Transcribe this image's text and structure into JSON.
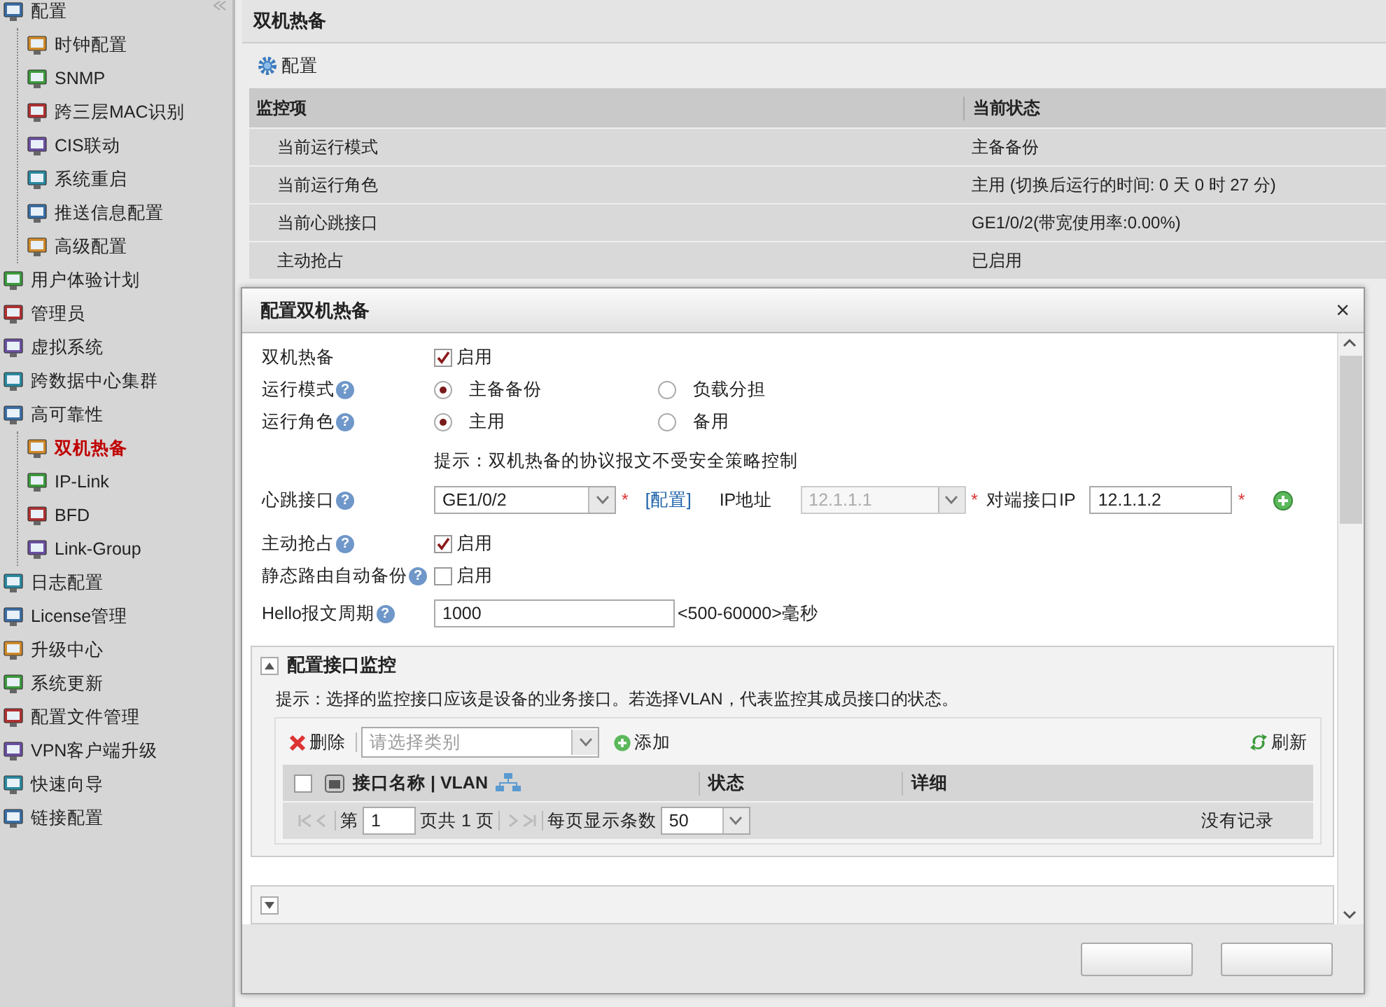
{
  "sidebar": {
    "items": [
      {
        "label": "配置",
        "selected": false,
        "children": [
          {
            "label": "时钟配置",
            "selected": false
          },
          {
            "label": "SNMP",
            "selected": false
          },
          {
            "label": "跨三层MAC识别",
            "selected": false
          },
          {
            "label": "CIS联动",
            "selected": false
          },
          {
            "label": "系统重启",
            "selected": false
          },
          {
            "label": "推送信息配置",
            "selected": false
          },
          {
            "label": "高级配置",
            "selected": false
          }
        ]
      },
      {
        "label": "用户体验计划",
        "selected": false
      },
      {
        "label": "管理员",
        "selected": false
      },
      {
        "label": "虚拟系统",
        "selected": false
      },
      {
        "label": "跨数据中心集群",
        "selected": false
      },
      {
        "label": "高可靠性",
        "selected": false,
        "children": [
          {
            "label": "双机热备",
            "selected": true
          },
          {
            "label": "IP-Link",
            "selected": false
          },
          {
            "label": "BFD",
            "selected": false
          },
          {
            "label": "Link-Group",
            "selected": false
          }
        ]
      },
      {
        "label": "日志配置",
        "selected": false
      },
      {
        "label": "License管理",
        "selected": false
      },
      {
        "label": "升级中心",
        "selected": false
      },
      {
        "label": "系统更新",
        "selected": false
      },
      {
        "label": "配置文件管理",
        "selected": false
      },
      {
        "label": "VPN客户端升级",
        "selected": false
      },
      {
        "label": "快速向导",
        "selected": false
      },
      {
        "label": "链接配置",
        "selected": false
      }
    ]
  },
  "panel": {
    "title": "双机热备",
    "toolbar_button": "配置",
    "table": {
      "columns": [
        "监控项",
        "当前状态"
      ],
      "rows": [
        [
          "当前运行模式",
          "主备备份"
        ],
        [
          "当前运行角色",
          "主用 (切换后运行的时间: 0 天 0 时 27 分)"
        ],
        [
          "当前心跳接口",
          "GE1/0/2(带宽使用率:0.00%)"
        ],
        [
          "主动抢占",
          "已启用"
        ]
      ]
    }
  },
  "dialog": {
    "title": "配置双机热备",
    "close": "×",
    "fields": [
      {
        "kind": "checkbox",
        "label": "双机热备",
        "checked": true,
        "option": "启用"
      },
      {
        "kind": "radio",
        "label": "运行模式",
        "help": "?",
        "options": [
          {
            "label": "主备备份",
            "selected": true
          },
          {
            "label": "负载分担",
            "selected": false
          }
        ]
      },
      {
        "kind": "radio",
        "label": "运行角色",
        "help": "?",
        "options": [
          {
            "label": "主用",
            "selected": true
          },
          {
            "label": "备用",
            "selected": false
          }
        ]
      },
      {
        "kind": "note",
        "text": "提示：双机热备的协议报文不受安全策略控制"
      },
      {
        "kind": "heartbeat",
        "label": "心跳接口",
        "help": "?",
        "value": "GE1/0/2",
        "required": "*",
        "link": "[配置]",
        "ip_label": "IP地址",
        "ip_value": "12.1.1.1",
        "ip_disabled": true,
        "ip_required": "*",
        "peer_label": "对端接口IP",
        "peer_value": "12.1.1.2",
        "peer_required": "*"
      },
      {
        "kind": "checkbox",
        "label": "主动抢占",
        "help": "?",
        "checked": true,
        "option": "启用"
      },
      {
        "kind": "checkbox",
        "label": "静态路由自动备份",
        "help": "?",
        "checked": false,
        "option": "启用"
      },
      {
        "kind": "number",
        "label": "Hello报文周期",
        "help": "?",
        "value": "1000",
        "hint": "<500-60000>毫秒"
      }
    ],
    "sections": [
      {
        "title": "配置接口监控",
        "expanded": true,
        "note": "提示：选择的监控接口应该是设备的业务接口。若选择VLAN，代表监控其成员接口的状态。",
        "toolbar": {
          "delete": "删除",
          "category_placeholder": "请选择类别",
          "add": "添加",
          "refresh": "刷新"
        },
        "select_all": false,
        "columns": [
          "接口名称 | VLAN",
          "状态",
          "详细"
        ],
        "pager": {
          "page_prefix": "第",
          "page": "1",
          "page_suffix": "页共 1 页",
          "per_page_label": "每页显示条数",
          "per_page": "50",
          "empty": "没有记录"
        }
      },
      {
        "expanded": false
      }
    ]
  }
}
